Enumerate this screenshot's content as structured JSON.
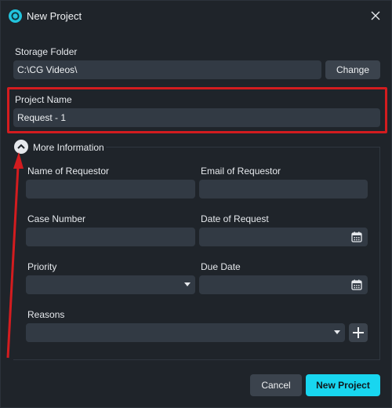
{
  "window": {
    "title": "New Project"
  },
  "storage": {
    "label": "Storage Folder",
    "value": "C:\\CG Videos\\",
    "change_label": "Change"
  },
  "project": {
    "label": "Project Name",
    "value": "Request - 1"
  },
  "more": {
    "section_label": "More Information",
    "requestor_name_label": "Name of Requestor",
    "requestor_email_label": "Email of Requestor",
    "case_number_label": "Case Number",
    "date_of_request_label": "Date of Request",
    "priority_label": "Priority",
    "due_date_label": "Due Date",
    "reasons_label": "Reasons"
  },
  "footer": {
    "cancel_label": "Cancel",
    "new_project_label": "New Project"
  },
  "colors": {
    "accent": "#18d6f0",
    "annotation": "#d31c1f",
    "field": "#323a44",
    "background": "#1f242a"
  }
}
